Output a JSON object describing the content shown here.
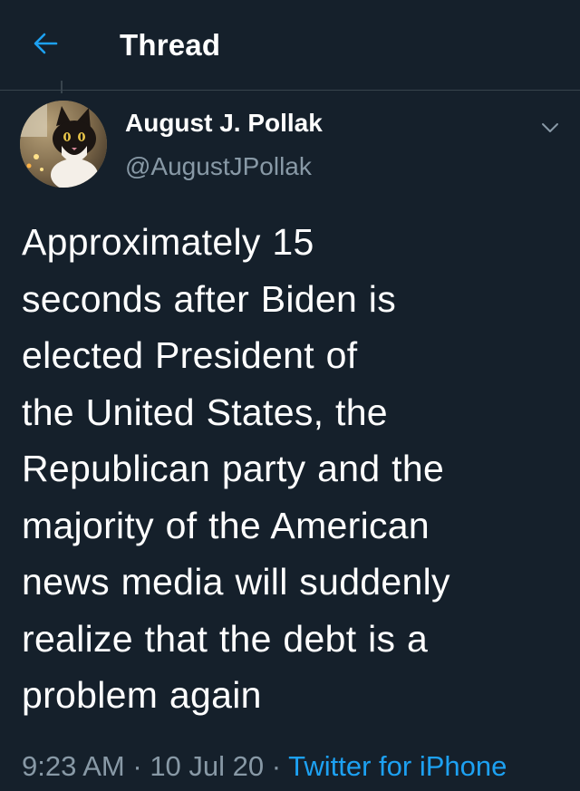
{
  "header": {
    "title": "Thread"
  },
  "author": {
    "name": "August J. Pollak",
    "handle": "@AugustJPollak"
  },
  "tweet": {
    "lines": [
      "Approximately 15",
      "seconds after Biden is",
      "elected President of",
      "the United States, the",
      "Republican party and the",
      "majority of the American",
      "news media will suddenly",
      "realize that the debt is a",
      "problem again"
    ]
  },
  "meta": {
    "time": "9:23 AM",
    "sep1": " · ",
    "date": "10 Jul 20",
    "sep2": " · ",
    "source": "Twitter for iPhone"
  },
  "colors": {
    "background": "#15202b",
    "accent": "#1da1f2",
    "muted": "#8899a6"
  },
  "icons": {
    "back": "back-arrow-icon",
    "caret": "chevron-down-icon"
  }
}
